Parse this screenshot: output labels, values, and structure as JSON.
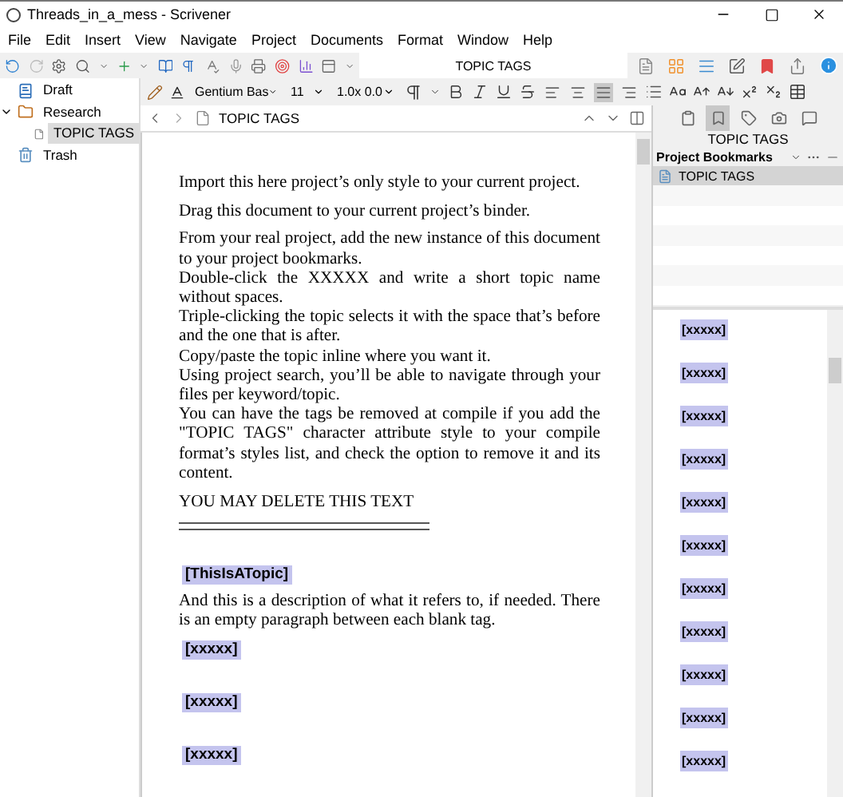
{
  "window": {
    "title": "Threads_in_a_mess - Scrivener"
  },
  "menu": [
    "File",
    "Edit",
    "Insert",
    "View",
    "Navigate",
    "Project",
    "Documents",
    "Format",
    "Window",
    "Help"
  ],
  "header_title": "TOPIC TAGS",
  "binder": [
    {
      "label": "Draft",
      "kind": "draft",
      "selected": false
    },
    {
      "label": "Research",
      "kind": "folder",
      "selected": false,
      "expanded": true,
      "children": [
        {
          "label": "TOPIC TAGS",
          "kind": "doc",
          "selected": true
        }
      ]
    },
    {
      "label": "Trash",
      "kind": "trash",
      "selected": false
    }
  ],
  "format_bar": {
    "font": "Gentium Bas",
    "size": "11",
    "spacing": "1.0x 0.0",
    "alignments": [
      {
        "kind": "left",
        "selected": false
      },
      {
        "kind": "center",
        "selected": false
      },
      {
        "kind": "justify",
        "selected": true
      },
      {
        "kind": "right",
        "selected": false
      }
    ]
  },
  "editor": {
    "title": "TOPIC TAGS",
    "blocks": [
      {
        "kind": "text",
        "text": "Import this here project’s only style to your current project."
      },
      {
        "kind": "text",
        "text": "Drag this document to your current project’s binder."
      },
      {
        "kind": "group",
        "lines": [
          "From your real project, add the new instance of this document to your project bookmarks.",
          "Double-click the XXXXX and write a short topic name without spaces.",
          "Triple-clicking the topic selects it with the space that’s before and the one that is after.",
          "Copy/paste the topic inline where you want it.",
          "Using project search, you’ll be able to navigate through your files per keyword/topic.",
          "You can have the tags be removed at compile if you add the \"TOPIC TAGS\" character attribute style to your compile format’s styles list, and check the option to remove it and its content."
        ]
      },
      {
        "kind": "text",
        "text": "YOU MAY DELETE THIS TEXT"
      },
      {
        "kind": "rule"
      },
      {
        "kind": "tag",
        "text": "[ThisIsATopic]"
      },
      {
        "kind": "text",
        "text": "And this is a description of what it refers to, if needed. There is an empty paragraph between each blank tag."
      },
      {
        "kind": "tag",
        "text": "[xxxxx]"
      },
      {
        "kind": "blank"
      },
      {
        "kind": "tag",
        "text": "[xxxxx]"
      },
      {
        "kind": "blank"
      },
      {
        "kind": "tag",
        "text": "[xxxxx]"
      }
    ]
  },
  "inspector": {
    "tabs": [
      {
        "kind": "notes",
        "selected": false
      },
      {
        "kind": "bookmarks",
        "selected": true
      },
      {
        "kind": "metadata",
        "selected": false
      },
      {
        "kind": "snapshots",
        "selected": false
      },
      {
        "kind": "comments",
        "selected": false
      }
    ],
    "title": "TOPIC TAGS",
    "dropdown": "Project Bookmarks",
    "bookmarks": [
      {
        "label": "TOPIC TAGS",
        "selected": true
      }
    ],
    "preview_tags": [
      "[xxxxx]",
      "[xxxxx]",
      "[xxxxx]",
      "[xxxxx]",
      "[xxxxx]",
      "[xxxxx]",
      "[xxxxx]",
      "[xxxxx]",
      "[xxxxx]",
      "[xxxxx]",
      "[xxxxx]"
    ]
  }
}
